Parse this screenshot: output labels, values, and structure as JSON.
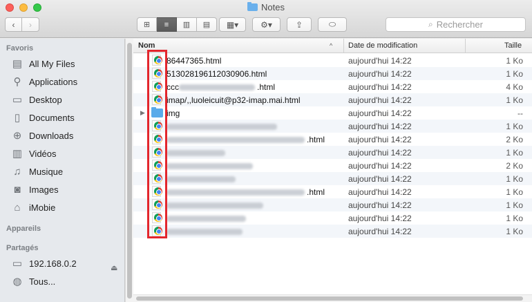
{
  "window": {
    "title": "Notes"
  },
  "toolbar": {
    "back_glyph": "‹",
    "forward_glyph": "›",
    "view_glyphs": [
      "⊞",
      "≡",
      "▥",
      "▤"
    ],
    "arrange_glyph": "▦▾",
    "action_glyph": "⚙▾",
    "share_glyph": "⇪",
    "tag_glyph": "⬭",
    "search_placeholder": "Rechercher",
    "search_icon": "⌕"
  },
  "sidebar": {
    "favorites_header": "Favoris",
    "favorites": [
      {
        "label": "All My Files",
        "icon": "all-files-icon",
        "glyph": "▤"
      },
      {
        "label": "Applications",
        "icon": "applications-icon",
        "glyph": "⚲"
      },
      {
        "label": "Desktop",
        "icon": "desktop-icon",
        "glyph": "▭"
      },
      {
        "label": "Documents",
        "icon": "documents-icon",
        "glyph": "▯"
      },
      {
        "label": "Downloads",
        "icon": "downloads-icon",
        "glyph": "⊕"
      },
      {
        "label": "Vidéos",
        "icon": "videos-icon",
        "glyph": "▥"
      },
      {
        "label": "Musique",
        "icon": "music-icon",
        "glyph": "♫"
      },
      {
        "label": "Images",
        "icon": "images-icon",
        "glyph": "◙"
      },
      {
        "label": "iMobie",
        "icon": "home-icon",
        "glyph": "⌂"
      }
    ],
    "devices_header": "Appareils",
    "shared_header": "Partagés",
    "shared": [
      {
        "label": "192.168.0.2",
        "icon": "server-icon",
        "glyph": "▭"
      },
      {
        "label": "Tous...",
        "icon": "network-icon",
        "glyph": "◍"
      }
    ],
    "eject_glyph": "⏏"
  },
  "columns": {
    "name": "Nom",
    "sort_glyph": "^",
    "date": "Date de modification",
    "size": "Taille"
  },
  "files": [
    {
      "name": "86447365.html",
      "date": "aujourd'hui 14:22",
      "size": "1 Ko",
      "kind": "html"
    },
    {
      "name": "513028196112030906.html",
      "date": "aujourd'hui 14:22",
      "size": "1 Ko",
      "kind": "html"
    },
    {
      "name": "ccc",
      "suffix": ".html",
      "date": "aujourd'hui 14:22",
      "size": "4 Ko",
      "kind": "html",
      "blur": 110
    },
    {
      "name": "imap/,,luoleicuit@p32-imap.mai.html",
      "date": "aujourd'hui 14:22",
      "size": "1 Ko",
      "kind": "html"
    },
    {
      "name": "img",
      "date": "aujourd'hui 14:22",
      "size": "--",
      "kind": "folder"
    },
    {
      "name": "",
      "date": "aujourd'hui 14:22",
      "size": "1 Ko",
      "kind": "html",
      "blur": 160
    },
    {
      "name": "",
      "suffix": ".html",
      "date": "aujourd'hui 14:22",
      "size": "2 Ko",
      "kind": "html",
      "blur": 200
    },
    {
      "name": "",
      "date": "aujourd'hui 14:22",
      "size": "1 Ko",
      "kind": "html",
      "blur": 85
    },
    {
      "name": "",
      "date": "aujourd'hui 14:22",
      "size": "2 Ko",
      "kind": "html",
      "blur": 125
    },
    {
      "name": "",
      "date": "aujourd'hui 14:22",
      "size": "1 Ko",
      "kind": "html",
      "blur": 100
    },
    {
      "name": "",
      "suffix": ".html",
      "date": "aujourd'hui 14:22",
      "size": "1 Ko",
      "kind": "html",
      "blur": 200
    },
    {
      "name": "",
      "date": "aujourd'hui 14:22",
      "size": "1 Ko",
      "kind": "html",
      "blur": 140
    },
    {
      "name": "",
      "date": "aujourd'hui 14:22",
      "size": "1 Ko",
      "kind": "html",
      "blur": 115
    },
    {
      "name": "",
      "date": "aujourd'hui 14:22",
      "size": "1 Ko",
      "kind": "html",
      "blur": 110
    }
  ],
  "colors": {
    "highlight": "#e3262d",
    "folder": "#5aabea",
    "selected_view": "#5b5b5b"
  }
}
